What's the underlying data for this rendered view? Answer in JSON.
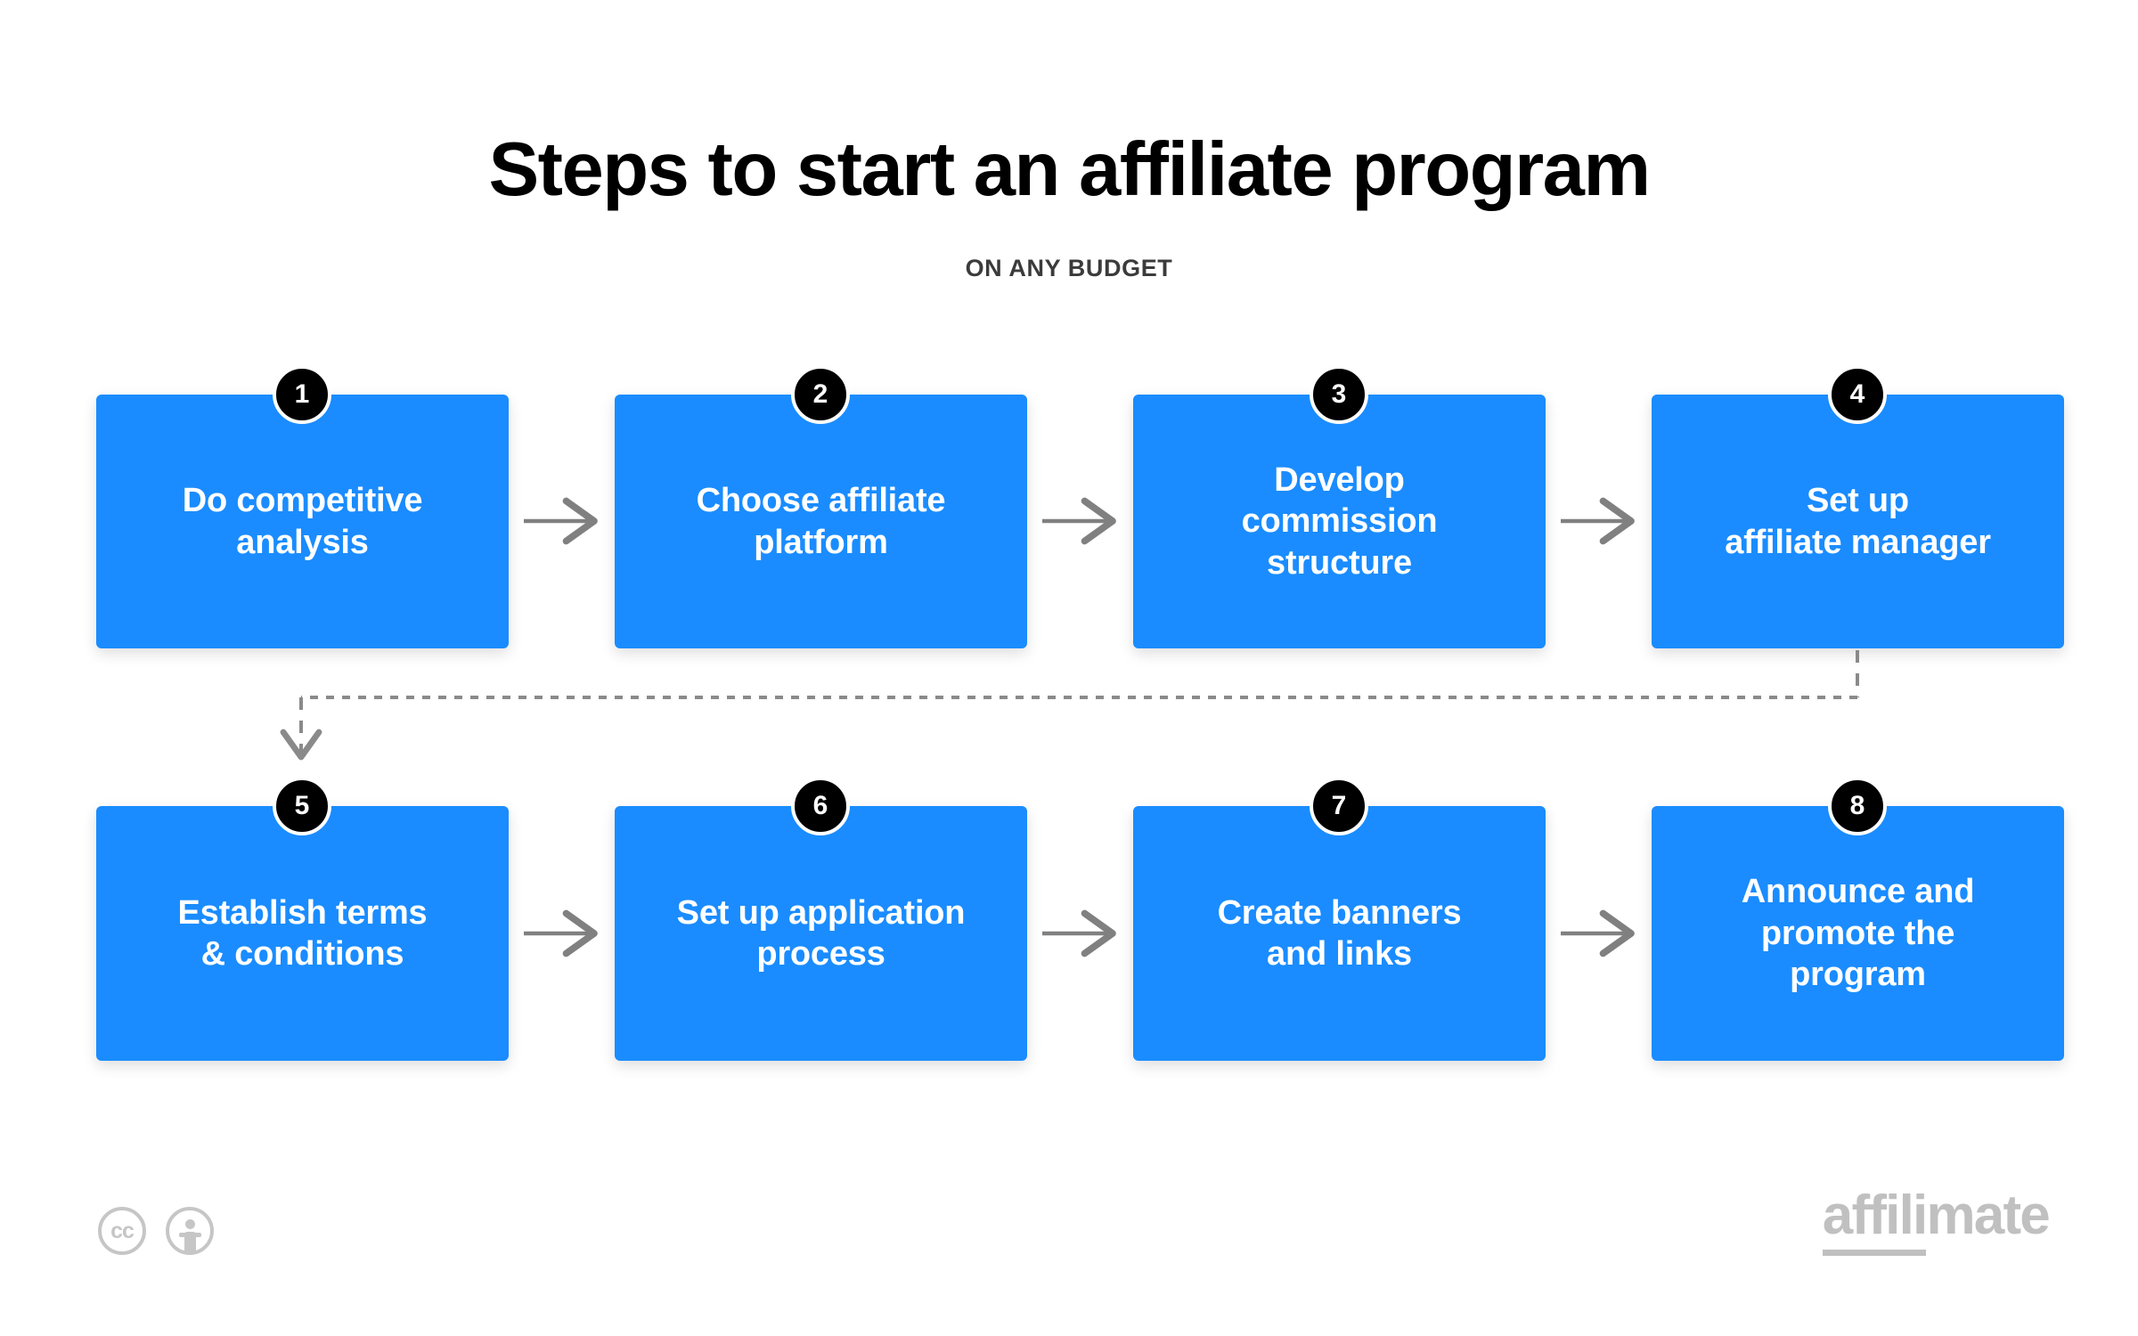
{
  "header": {
    "title": "Steps to start an affiliate program",
    "subtitle": "ON ANY BUDGET"
  },
  "colors": {
    "box_blue": "#1a8cff",
    "badge_black": "#000000",
    "connector_gray": "#808080",
    "footer_gray": "#c0c0c0",
    "background": "#ffffff"
  },
  "steps": [
    {
      "number": "1",
      "label": "Do competitive\nanalysis"
    },
    {
      "number": "2",
      "label": "Choose affiliate\nplatform"
    },
    {
      "number": "3",
      "label": "Develop\ncommission\nstructure"
    },
    {
      "number": "4",
      "label": "Set up\naffiliate manager"
    },
    {
      "number": "5",
      "label": "Establish terms\n& conditions"
    },
    {
      "number": "6",
      "label": "Set up application\nprocess"
    },
    {
      "number": "7",
      "label": "Create banners\nand links"
    },
    {
      "number": "8",
      "label": "Announce and\npromote the\nprogram"
    }
  ],
  "connectors": {
    "solid_arrows": 6,
    "wrap_arrow_style": "dashed"
  },
  "footer": {
    "license_cc_label": "cc",
    "license_by_label": "attribution",
    "brand_underlined": "affili",
    "brand_rest": "mate"
  }
}
